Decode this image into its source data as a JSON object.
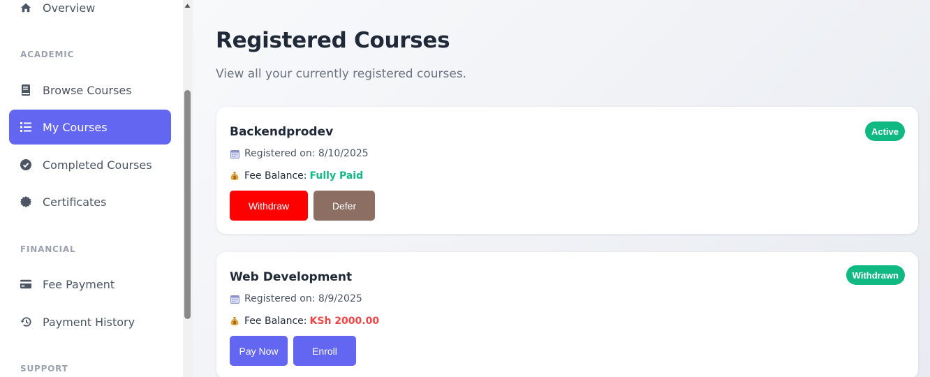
{
  "sidebar": {
    "overview_label": "Overview",
    "sections": {
      "academic": "ACADEMIC",
      "financial": "FINANCIAL",
      "support": "SUPPORT"
    },
    "items": [
      {
        "label": "Browse Courses",
        "icon": "book-icon"
      },
      {
        "label": "My Courses",
        "icon": "list-icon",
        "active": true
      },
      {
        "label": "Completed Courses",
        "icon": "check-circle-icon"
      },
      {
        "label": "Certificates",
        "icon": "certificate-icon"
      },
      {
        "label": "Fee Payment",
        "icon": "credit-card-icon"
      },
      {
        "label": "Payment History",
        "icon": "history-icon"
      }
    ],
    "accent_color": "#6366f1"
  },
  "main": {
    "title": "Registered Courses",
    "subtitle": "View all your currently registered courses."
  },
  "courses": [
    {
      "name": "Backendprodev",
      "status": "Active",
      "registered": "Registered on: 8/10/2025",
      "fee_label": "Fee Balance:",
      "fee_value": "Fully Paid",
      "actions": [
        "Withdraw",
        "Defer"
      ]
    },
    {
      "name": "Web Development",
      "status": "Withdrawn",
      "registered": "Registered on: 8/9/2025",
      "fee_label": "Fee Balance:",
      "fee_value": "KSh 2000.00",
      "actions": [
        "Pay Now",
        "Enroll"
      ]
    }
  ],
  "colors": {
    "status_green": "#10b981",
    "withdraw_red": "#ff0000",
    "defer_brown": "#8d6e63",
    "primary_purple": "#6366f1",
    "due_red": "#ef4444"
  }
}
